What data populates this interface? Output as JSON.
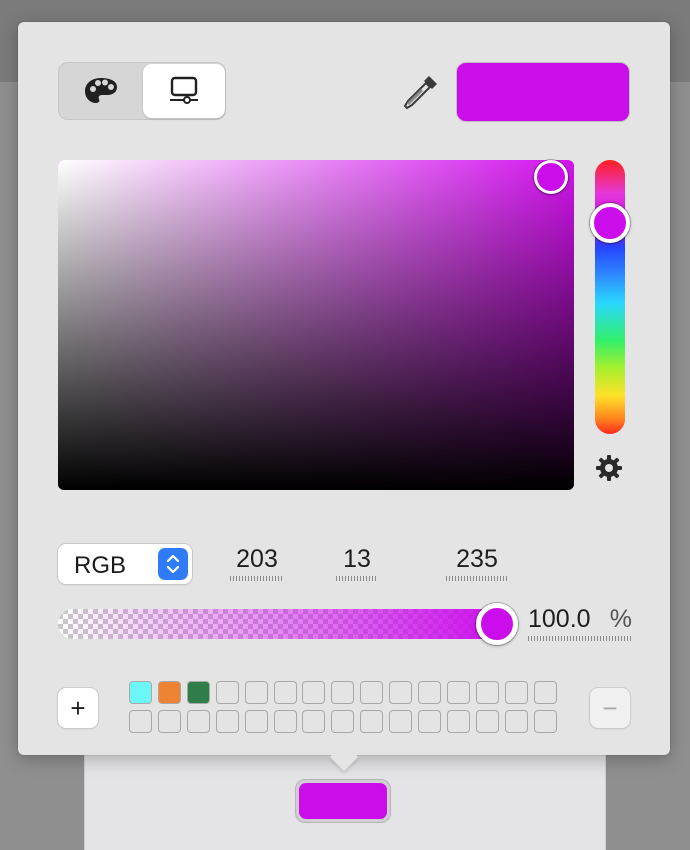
{
  "colors": {
    "selected": "#CB0DEB",
    "accent_blue": "#2F7CF6"
  },
  "mode_tabs": [
    {
      "name": "color-palettes",
      "icon": "palette-icon",
      "selected": false
    },
    {
      "name": "color-sliders",
      "icon": "sliders-monitor-icon",
      "selected": true
    }
  ],
  "hue_level": 0.24,
  "alpha_level": 1.0,
  "color_model": {
    "selected": "RGB"
  },
  "channels": {
    "red": "203",
    "green": "13",
    "blue": "235"
  },
  "opacity": {
    "value": "100.0",
    "unit": "%"
  },
  "swatches": {
    "filled": [
      "#6CF7F7",
      "#EE8433",
      "#2F7D49"
    ],
    "total_slots": 30
  },
  "icons": {
    "eyedropper": "eyedropper-icon",
    "settings": "gear-icon",
    "add": "plus-icon",
    "remove": "minus-icon",
    "stepper": "chevron-updown-icon"
  },
  "labels": {
    "add": "+",
    "remove": "−"
  }
}
